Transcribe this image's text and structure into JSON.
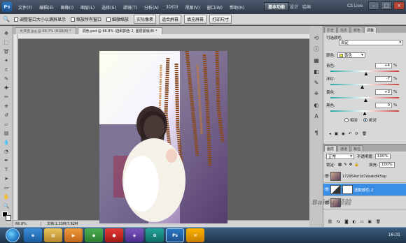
{
  "menubar": {
    "logo": "Ps",
    "items": [
      "文件(F)",
      "编辑(E)",
      "图像(I)",
      "图层(L)",
      "选择(S)",
      "滤镜(T)",
      "分析(A)",
      "3D(D)",
      "视图(V)",
      "窗口(W)",
      "帮助(H)"
    ],
    "zoom_value": "66.8",
    "workspace_active": "基本功能",
    "workspace_design": "设计",
    "workspace_paint": "绘画",
    "cs_live": "CS Live"
  },
  "options": {
    "check1": "调整窗口大小以满屏显示",
    "check2": "缩放所有窗口",
    "check3": "细微缩放",
    "btn_actual": "实际像素",
    "btn_fit": "适合屏幕",
    "btn_fill": "填充屏幕",
    "btn_print": "打印尺寸"
  },
  "tabs": {
    "tab1": "大日皮.jpg @ 66.7% (RGB/8) *",
    "tab2": "调色.psd @ 66.8% (选取颜色 2, 图层蒙版/8) *"
  },
  "status": {
    "zoom": "66.8%",
    "doc": "文档:1.33M/7.82M"
  },
  "adjust_panel": {
    "tab_history": "历史",
    "tab_info": "信息",
    "tab_color": "颜色",
    "tab_adjust": "调整",
    "title": "可选颜色",
    "preset": "自定",
    "colors_label": "颜色:",
    "color_value": "黄色",
    "cyan_label": "青色:",
    "cyan_value": "+4",
    "magenta_label": "洋红:",
    "magenta_value": "-7",
    "yellow_label": "黄色:",
    "yellow_value": "+3",
    "black_label": "黑色:",
    "black_value": "0",
    "percent": "%",
    "relative": "相对",
    "absolute": "绝对"
  },
  "adjust_levels": {
    "cyan": 4,
    "magenta": -7,
    "yellow": 3,
    "black": 0
  },
  "layers_panel": {
    "tab_layers": "图层",
    "tab_channels": "通道",
    "tab_paths": "路径",
    "blend_mode": "正常",
    "opacity_label": "不透明度:",
    "opacity_value": "100%",
    "lock_label": "锁定:",
    "fill_label": "填充:",
    "fill_value": "100%",
    "layer1": "172954or1d7daabdik5ap",
    "layer2": "选取颜色 2"
  },
  "taskbar": {
    "clock": "16:31"
  },
  "watermark": "Baidu 经验"
}
